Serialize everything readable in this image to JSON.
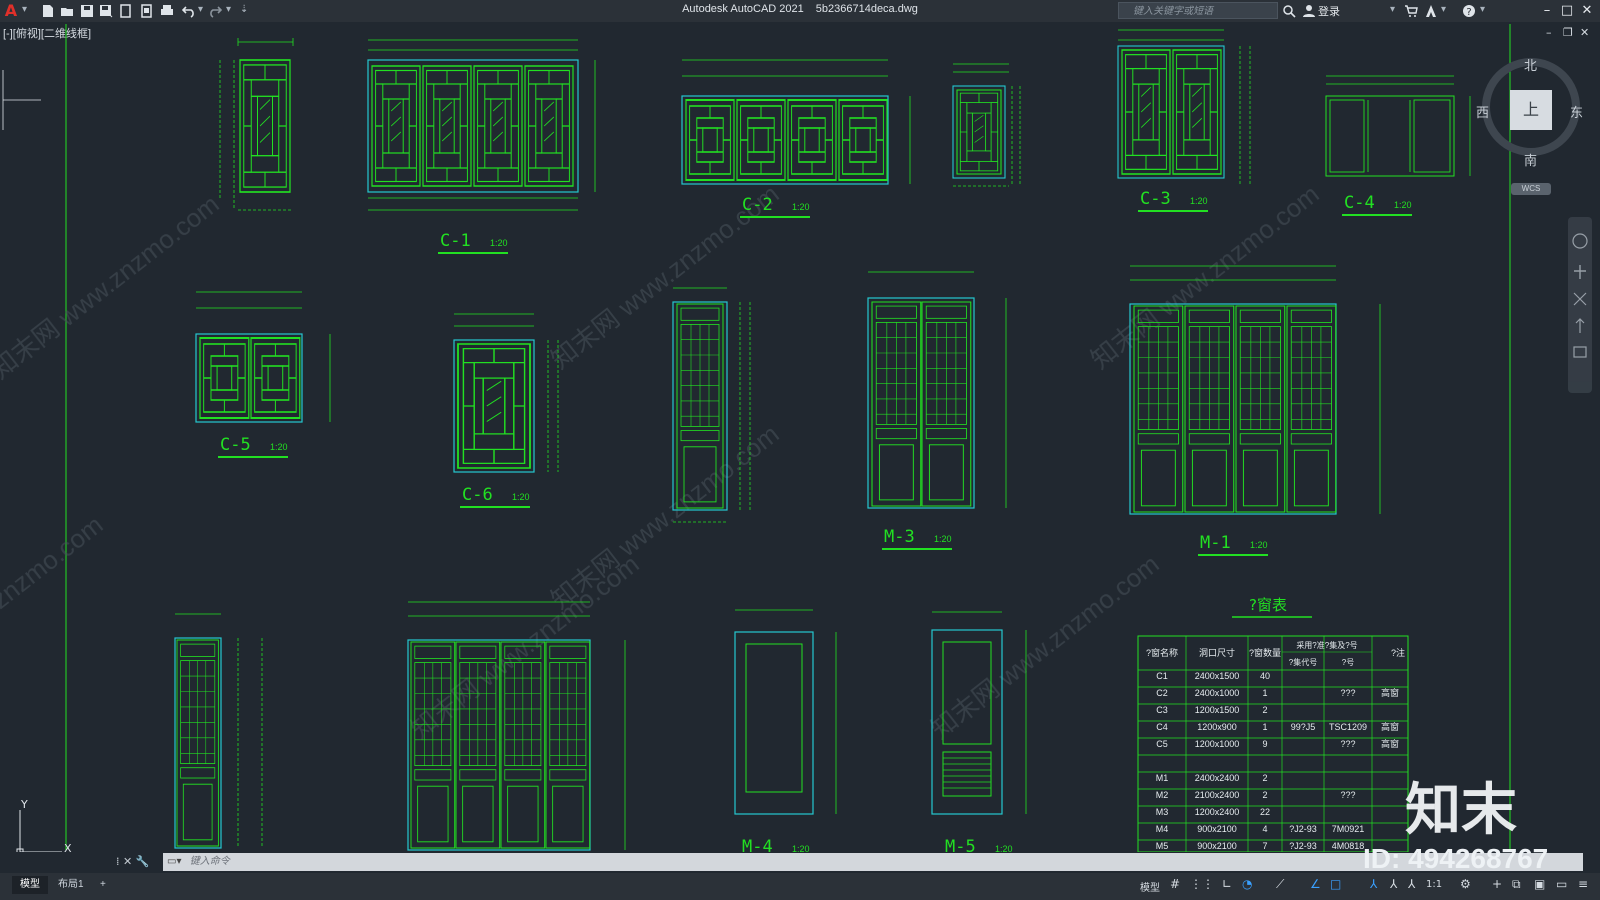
{
  "app": {
    "title": "Autodesk AutoCAD 2021",
    "file": "5b2366714deca.dwg",
    "search_placeholder": "键入关键字或短语",
    "login_label": "登录",
    "viewport_label": "[-][俯视][二维线框]"
  },
  "quick_access": [
    "new-icon",
    "open-icon",
    "save-icon",
    "saveas-icon",
    "publish-icon",
    "plot-icon",
    "print-icon",
    "undo-icon",
    "redo-icon"
  ],
  "viewcube": {
    "north": "北",
    "south": "南",
    "east": "东",
    "west": "西",
    "top": "上",
    "wcs": "WCS"
  },
  "views": [
    {
      "name": "C-1",
      "scale": "1:20"
    },
    {
      "name": "C-2",
      "scale": "1:20"
    },
    {
      "name": "C-3",
      "scale": "1:20"
    },
    {
      "name": "C-4",
      "scale": "1:20"
    },
    {
      "name": "C-5",
      "scale": "1:20"
    },
    {
      "name": "C-6",
      "scale": "1:20"
    },
    {
      "name": "M-3",
      "scale": "1:20"
    },
    {
      "name": "M-1",
      "scale": "1:20"
    },
    {
      "name": "M-4",
      "scale": "1:20"
    },
    {
      "name": "M-5",
      "scale": "1:20"
    }
  ],
  "schedule": {
    "title": "?窗表",
    "headers": [
      "?窗名称",
      "洞口尺寸",
      "?窗数量",
      "采用?准?集及?号",
      "?注"
    ],
    "subheaders": [
      "?集代号",
      "?号"
    ],
    "rows": [
      [
        "C1",
        "2400x1500",
        "40",
        "",
        "",
        ""
      ],
      [
        "C2",
        "2400x1000",
        "1",
        "",
        "???",
        "高窗"
      ],
      [
        "C3",
        "1200x1500",
        "2",
        "",
        "",
        ""
      ],
      [
        "C4",
        "1200x900",
        "1",
        "99?J5",
        "TSC1209",
        "高窗"
      ],
      [
        "C5",
        "1200x1000",
        "9",
        "",
        "???",
        "高窗"
      ],
      [
        "M1",
        "2400x2400",
        "2",
        "",
        "",
        ""
      ],
      [
        "M2",
        "2100x2400",
        "2",
        "",
        "???",
        ""
      ],
      [
        "M3",
        "1200x2400",
        "22",
        "",
        "",
        ""
      ],
      [
        "M4",
        "900x2100",
        "4",
        "?J2-93",
        "7M0921",
        ""
      ],
      [
        "M5",
        "900x2100",
        "7",
        "?J2-93",
        "4M0818",
        ""
      ]
    ]
  },
  "command_line": {
    "placeholder": "键入命令"
  },
  "tabs": [
    "模型",
    "布局1",
    "+"
  ],
  "status": {
    "model": "模型",
    "scale": "1:1"
  },
  "watermark": {
    "logo": "知末",
    "id": "ID: 494268767",
    "site": "知末网 www.znzmo.com"
  },
  "colors": {
    "background": "#212830",
    "line_green": "#22e022",
    "line_cyan": "#25c8d0",
    "ui_dark": "#2b3138"
  }
}
